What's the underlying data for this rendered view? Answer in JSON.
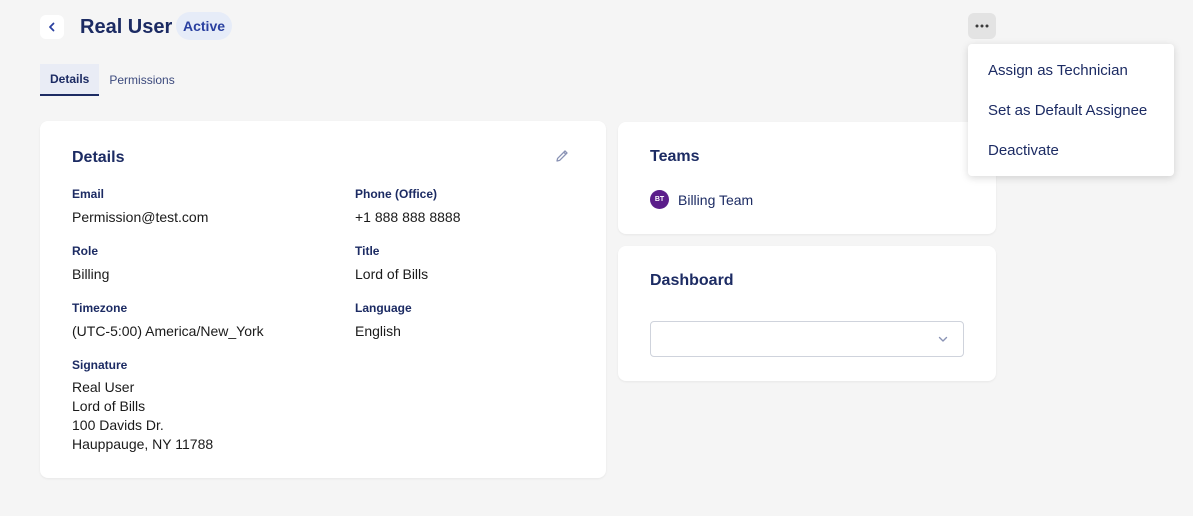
{
  "header": {
    "title": "Real User",
    "status": "Active",
    "back_icon": "chevron-left-icon",
    "more_icon": "ellipsis-icon"
  },
  "tabs": [
    {
      "label": "Details",
      "active": true
    },
    {
      "label": "Permissions",
      "active": false
    }
  ],
  "details_card": {
    "title": "Details",
    "edit_icon": "pencil-icon",
    "fields": {
      "email": {
        "label": "Email",
        "value": "Permission@test.com"
      },
      "phone": {
        "label": "Phone (Office)",
        "value": "+1 888 888 8888"
      },
      "role": {
        "label": "Role",
        "value": "Billing"
      },
      "title": {
        "label": "Title",
        "value": "Lord of Bills"
      },
      "timezone": {
        "label": "Timezone",
        "value": "(UTC-5:00) America/New_York"
      },
      "language": {
        "label": "Language",
        "value": "English"
      }
    },
    "signature": {
      "label": "Signature",
      "lines": [
        "Real User",
        "Lord of Bills",
        "100 Davids Dr.",
        "Hauppauge, NY 11788"
      ]
    }
  },
  "teams_card": {
    "title": "Teams",
    "teams": [
      {
        "initials": "BT",
        "name": "Billing Team",
        "color": "#5b1d8a"
      }
    ]
  },
  "dashboard_card": {
    "title": "Dashboard",
    "select_value": "",
    "select_icon": "chevron-down-icon"
  },
  "menu": {
    "items": [
      "Assign as Technician",
      "Set as Default Assignee",
      "Deactivate"
    ]
  },
  "colors": {
    "primary": "#1c2b63",
    "badge_bg": "#e6ecf8",
    "background": "#f5f5f5"
  }
}
